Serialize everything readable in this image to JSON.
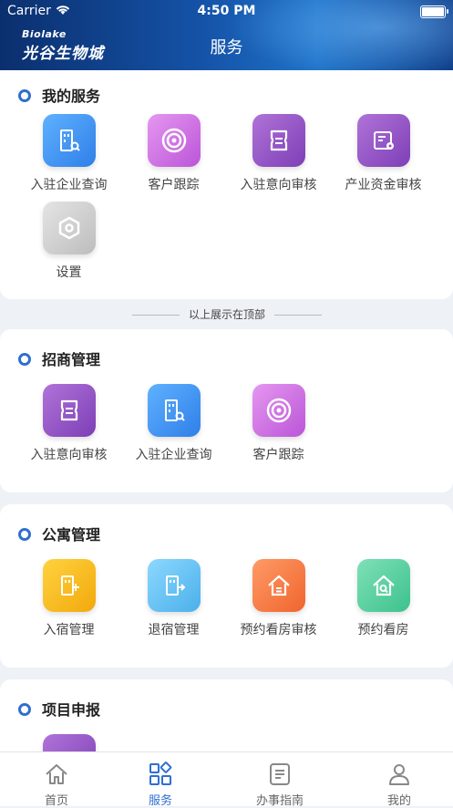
{
  "status_bar": {
    "carrier": "Carrier",
    "time": "4:50 PM"
  },
  "header": {
    "logo_en": "Biolake",
    "logo_zh": "光谷生物城",
    "title": "服务"
  },
  "my_services": {
    "title": "我的服务",
    "items": [
      {
        "label": "入驻企业查询",
        "icon": "building-search-icon",
        "color": "#3d8ff0"
      },
      {
        "label": "客户跟踪",
        "icon": "target-icon",
        "color": "#c866e0"
      },
      {
        "label": "入驻意向审核",
        "icon": "document-review-icon",
        "color": "#8f4fc4"
      },
      {
        "label": "产业资金审核",
        "icon": "fund-settings-icon",
        "color": "#8f4fc4"
      },
      {
        "label": "设置",
        "icon": "hexagon-settings-icon",
        "color": "#cfcfcf"
      }
    ]
  },
  "divider_text": "以上展示在顶部",
  "investment": {
    "title": "招商管理",
    "items": [
      {
        "label": "入驻意向审核",
        "icon": "document-review-icon"
      },
      {
        "label": "入驻企业查询",
        "icon": "building-search-icon"
      },
      {
        "label": "客户跟踪",
        "icon": "target-icon"
      }
    ]
  },
  "apartment": {
    "title": "公寓管理",
    "items": [
      {
        "label": "入宿管理",
        "icon": "check-in-icon",
        "color": "#f5b916"
      },
      {
        "label": "退宿管理",
        "icon": "check-out-icon",
        "color": "#5fc1f2"
      },
      {
        "label": "预约看房审核",
        "icon": "house-review-icon",
        "color": "#f57a45"
      },
      {
        "label": "预约看房",
        "icon": "house-search-icon",
        "color": "#4fcc9a"
      }
    ]
  },
  "project": {
    "title": "项目申报"
  },
  "tabbar": {
    "items": [
      {
        "label": "首页",
        "icon": "home-icon"
      },
      {
        "label": "服务",
        "icon": "services-grid-icon",
        "active": true
      },
      {
        "label": "办事指南",
        "icon": "guide-icon"
      },
      {
        "label": "我的",
        "icon": "user-icon"
      }
    ],
    "active_color": "#2f6fd0"
  }
}
